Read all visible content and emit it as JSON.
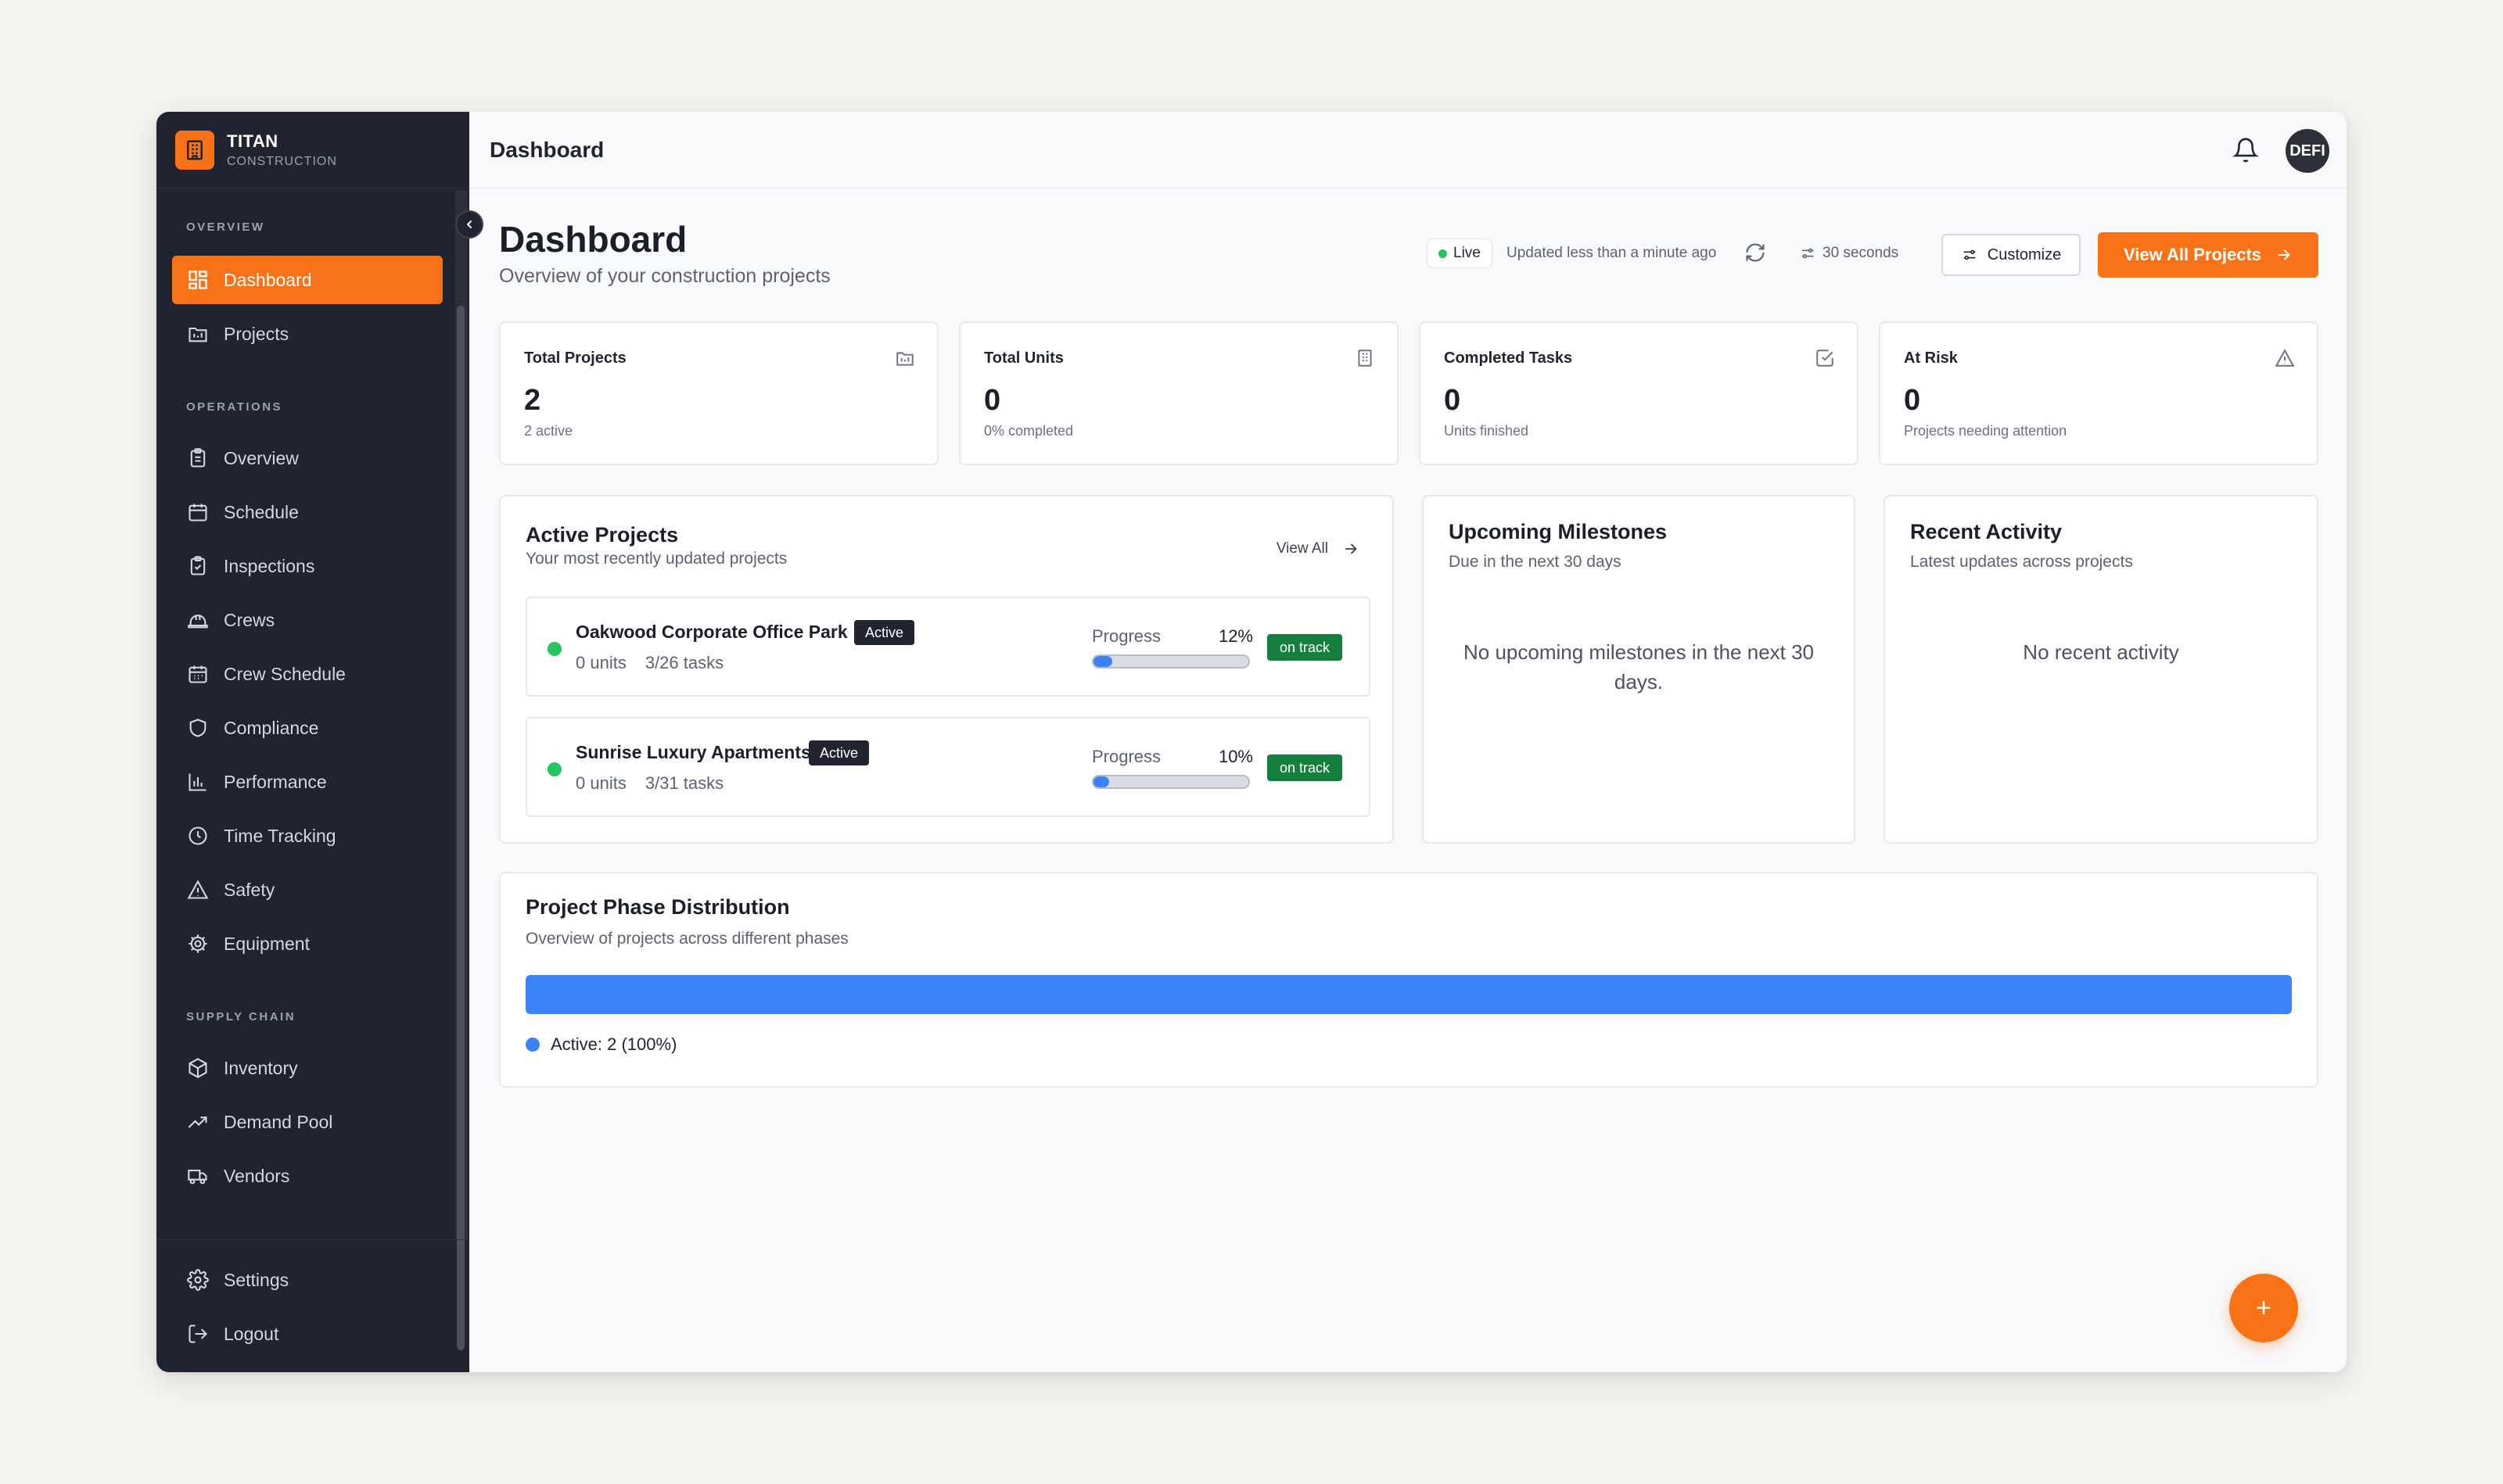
{
  "brand": {
    "name": "TITAN",
    "sub": "CONSTRUCTION"
  },
  "sidebar": {
    "sections": [
      {
        "label": "OVERVIEW"
      },
      {
        "label": "OPERATIONS"
      },
      {
        "label": "SUPPLY CHAIN"
      }
    ],
    "items": [
      {
        "label": "Dashboard",
        "icon": "dashboard-icon",
        "active": true
      },
      {
        "label": "Projects",
        "icon": "folder-icon"
      },
      {
        "label": "Overview",
        "icon": "clipboard-icon"
      },
      {
        "label": "Schedule",
        "icon": "calendar-icon"
      },
      {
        "label": "Inspections",
        "icon": "clipboard-check-icon"
      },
      {
        "label": "Crews",
        "icon": "hardhat-icon"
      },
      {
        "label": "Crew Schedule",
        "icon": "calendar-grid-icon"
      },
      {
        "label": "Compliance",
        "icon": "shield-icon"
      },
      {
        "label": "Performance",
        "icon": "bar-chart-icon"
      },
      {
        "label": "Time Tracking",
        "icon": "clock-icon"
      },
      {
        "label": "Safety",
        "icon": "warning-icon"
      },
      {
        "label": "Equipment",
        "icon": "cog-icon"
      },
      {
        "label": "Inventory",
        "icon": "box-icon"
      },
      {
        "label": "Demand Pool",
        "icon": "trending-up-icon"
      },
      {
        "label": "Vendors",
        "icon": "truck-icon"
      }
    ],
    "footer": [
      {
        "label": "Settings",
        "icon": "settings-icon"
      },
      {
        "label": "Logout",
        "icon": "logout-icon"
      }
    ]
  },
  "topbar": {
    "title": "Dashboard",
    "avatar": "DEFI"
  },
  "header": {
    "title": "Dashboard",
    "subtitle": "Overview of your construction projects",
    "live": "Live",
    "updated": "Updated less than a minute ago",
    "interval": "30 seconds",
    "customize": "Customize",
    "view_all_projects": "View All Projects"
  },
  "stats": [
    {
      "title": "Total Projects",
      "value": "2",
      "sub": "2 active",
      "icon": "folder-icon"
    },
    {
      "title": "Total Units",
      "value": "0",
      "sub": "0% completed",
      "icon": "building-icon"
    },
    {
      "title": "Completed Tasks",
      "value": "0",
      "sub": "Units finished",
      "icon": "check-square-icon"
    },
    {
      "title": "At Risk",
      "value": "0",
      "sub": "Projects needing attention",
      "icon": "alert-triangle-icon"
    }
  ],
  "active_projects": {
    "title": "Active Projects",
    "subtitle": "Your most recently updated projects",
    "view_all": "View All",
    "progress_label": "Progress",
    "items": [
      {
        "name": "Oakwood Corporate Office Park",
        "badge": "Active",
        "units": "0 units",
        "tasks": "3/26 tasks",
        "progress": "12%",
        "progress_value": 0.12,
        "status": "on track"
      },
      {
        "name": "Sunrise Luxury Apartments",
        "badge": "Active",
        "units": "0 units",
        "tasks": "3/31 tasks",
        "progress": "10%",
        "progress_value": 0.1,
        "status": "on track"
      }
    ]
  },
  "milestones": {
    "title": "Upcoming Milestones",
    "subtitle": "Due in the next 30 days",
    "empty": "No upcoming milestones in the next 30 days."
  },
  "activity": {
    "title": "Recent Activity",
    "subtitle": "Latest updates across projects",
    "empty": "No recent activity"
  },
  "phase": {
    "title": "Project Phase Distribution",
    "subtitle": "Overview of projects across different phases",
    "legend": "Active: 2 (100%)",
    "share": 1.0,
    "color": "#3b82f6"
  },
  "fab": "+",
  "colors": {
    "accent": "#f97316",
    "sidebar": "#1f2430",
    "success": "#22c55e",
    "progress": "#3b82f6"
  }
}
